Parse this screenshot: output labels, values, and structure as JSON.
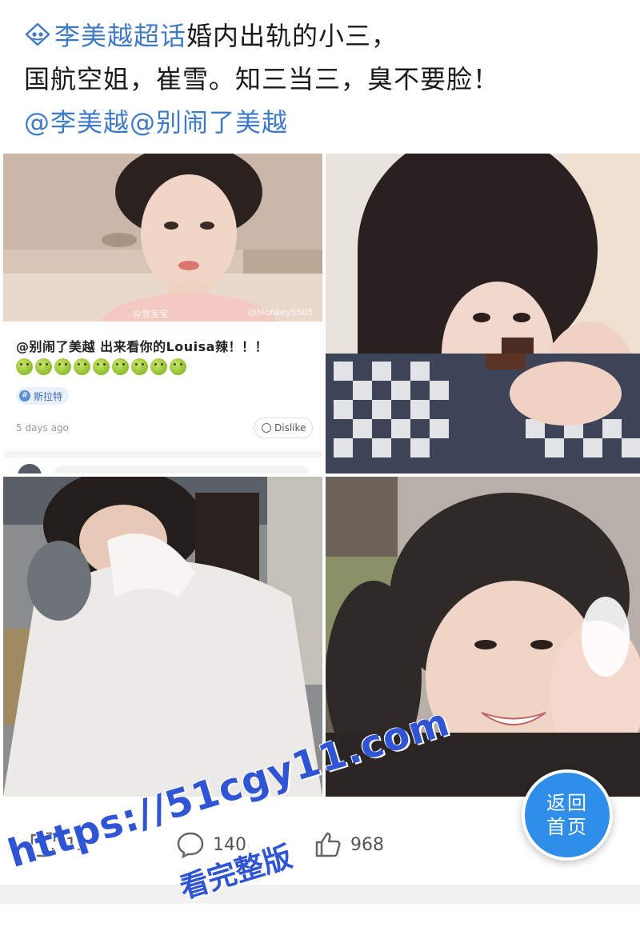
{
  "post": {
    "topic": "李美越超话",
    "text_line1_rest": "婚内出轨的小三，",
    "text_line2": "国航空姐，崔雪。知三当三，臭不要脸！",
    "mentions": "@李美越@别闹了美越"
  },
  "embedded_comment": {
    "watermark_left": "@雪宝宝",
    "watermark_right": "@MonkeySS05",
    "text": "@别闹了美越 出来看你的Louisa辣！！！",
    "hashtag": "斯拉特",
    "time": "5 days ago",
    "dislike_label": "Dislike"
  },
  "actions": {
    "share_count": "13",
    "comment_count": "140",
    "like_count": "968"
  },
  "home_button": {
    "line1": "返回",
    "line2": "首页"
  },
  "watermark": {
    "url": "https://51cgy11.com",
    "label": "看完整版"
  },
  "colors": {
    "link": "#3f7bc4",
    "home_button": "#2f8ee8",
    "watermark": "#2f55d4"
  }
}
